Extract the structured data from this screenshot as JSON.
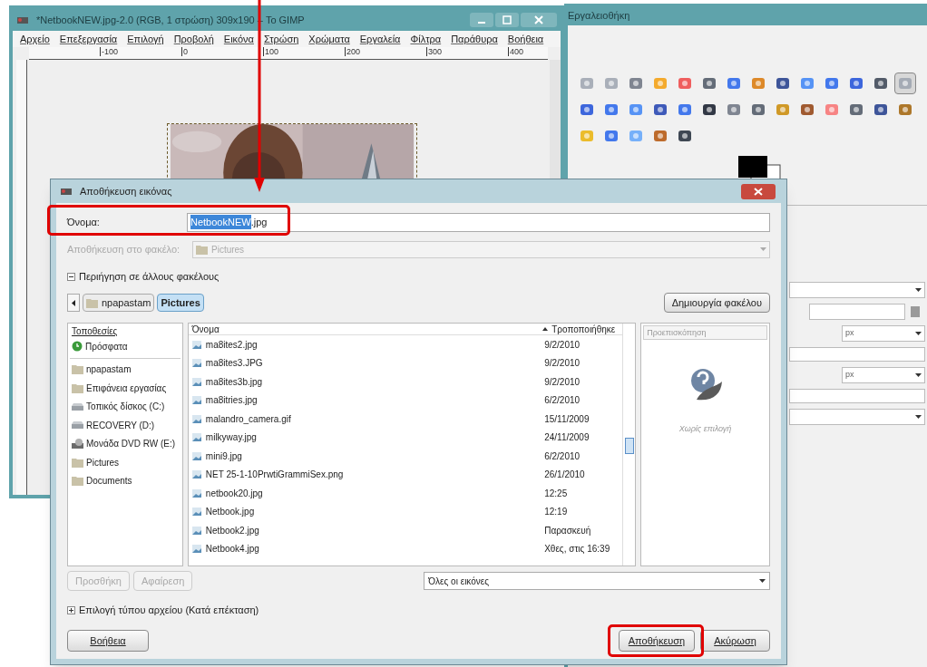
{
  "image_window": {
    "title": "*NetbookNEW.jpg-2.0 (RGB, 1 στρώση) 309x190 – Το GIMP",
    "menu": [
      "Αρχείο",
      "Επεξεργασία",
      "Επιλογή",
      "Προβολή",
      "Εικόνα",
      "Στρώση",
      "Χρώματα",
      "Εργαλεία",
      "Φίλτρα",
      "Παράθυρα",
      "Βοήθεια"
    ],
    "ruler_labels": [
      "-100",
      "0",
      "100",
      "200",
      "300",
      "400"
    ],
    "canvas": {
      "kind": "picture"
    }
  },
  "toolbox": {
    "title": "Εργαλειοθήκη",
    "tools": [
      {
        "selected": false
      },
      {
        "selected": false
      },
      {
        "selected": false
      },
      {
        "selected": false
      },
      {
        "selected": false
      },
      {
        "selected": false
      },
      {
        "selected": false
      },
      {
        "selected": false
      },
      {
        "selected": false
      },
      {
        "selected": false
      },
      {
        "selected": false
      },
      {
        "selected": false
      },
      {
        "selected": false
      },
      {
        "selected": true
      },
      {
        "selected": false
      },
      {
        "selected": false
      },
      {
        "selected": false
      },
      {
        "selected": false
      },
      {
        "selected": false
      },
      {
        "selected": false
      },
      {
        "selected": false
      },
      {
        "selected": false
      },
      {
        "selected": false
      },
      {
        "selected": false
      },
      {
        "selected": false
      },
      {
        "selected": false
      },
      {
        "selected": false
      },
      {
        "selected": false
      },
      {
        "selected": false
      },
      {
        "selected": false
      },
      {
        "selected": false
      },
      {
        "selected": false
      },
      {
        "selected": false
      }
    ],
    "options": [
      {
        "kind": "dropdown"
      },
      {
        "kind": "field"
      },
      {
        "kind": "unit",
        "value": "px"
      },
      {
        "kind": "spin"
      },
      {
        "kind": "unit",
        "value": "px"
      },
      {
        "kind": "spin"
      },
      {
        "kind": "dropdown"
      }
    ]
  },
  "dialog": {
    "title": "Αποθήκευση εικόνας",
    "name_label": "Όνομα:",
    "name_selected": "NetbookNEW",
    "name_rest": ".jpg",
    "folder_label": "Αποθήκευση στο φακέλο:",
    "folder_value": "Pictures",
    "browse_expander": {
      "label": "Περιήγηση σε άλλους φακέλους",
      "expanded": true
    },
    "path": [
      {
        "label": "npapastam",
        "selected": false
      },
      {
        "label": "Pictures",
        "selected": true
      }
    ],
    "create_folder": "Δημιουργία φακέλου",
    "places_header": "Τοποθεσίες",
    "places": [
      {
        "kind": "recent",
        "label": "Πρόσφατα"
      },
      {
        "kind": "folder",
        "label": "npapastam"
      },
      {
        "kind": "folder",
        "label": "Επιφάνεια εργασίας"
      },
      {
        "kind": "disk",
        "label": "Τοπικός δίσκος (C:)"
      },
      {
        "kind": "disk",
        "label": "RECOVERY (D:)"
      },
      {
        "kind": "dvd",
        "label": "Μονάδα DVD RW (E:)"
      },
      {
        "kind": "folder",
        "label": "Pictures"
      },
      {
        "kind": "folder",
        "label": "Documents"
      }
    ],
    "columns": [
      "Όνομα",
      "Τροποποιήθηκε"
    ],
    "files": [
      {
        "name": "ma8ites2.jpg",
        "modified": "9/2/2010"
      },
      {
        "name": "ma8ites3.JPG",
        "modified": "9/2/2010"
      },
      {
        "name": "ma8ites3b.jpg",
        "modified": "9/2/2010"
      },
      {
        "name": "ma8itries.jpg",
        "modified": "6/2/2010"
      },
      {
        "name": "malandro_camera.gif",
        "modified": "15/11/2009"
      },
      {
        "name": "milkyway.jpg",
        "modified": "24/11/2009"
      },
      {
        "name": "mini9.jpg",
        "modified": "6/2/2010"
      },
      {
        "name": "NET 25-1-10PrwtiGrammiSex.png",
        "modified": "26/1/2010"
      },
      {
        "name": "netbook20.jpg",
        "modified": "12:25"
      },
      {
        "name": "Netbook.jpg",
        "modified": "12:19"
      },
      {
        "name": "Netbook2.jpg",
        "modified": "Παρασκευή"
      },
      {
        "name": "Netbook4.jpg",
        "modified": "Χθες, στις 16:39"
      }
    ],
    "preview_header": "Προεπισκόπηση",
    "preview_text": "Χωρίς επιλογή",
    "add_button": {
      "label": "Προσθήκη",
      "disabled": true
    },
    "remove_button": {
      "label": "Αφαίρεση",
      "disabled": true
    },
    "filter": "Όλες οι εικόνες",
    "type_expander": {
      "label": "Επιλογή τύπου αρχείου (Κατά επέκταση)",
      "expanded": false
    },
    "help": "Βοήθεια",
    "save": "Αποθήκευση",
    "cancel": "Ακύρωση"
  }
}
